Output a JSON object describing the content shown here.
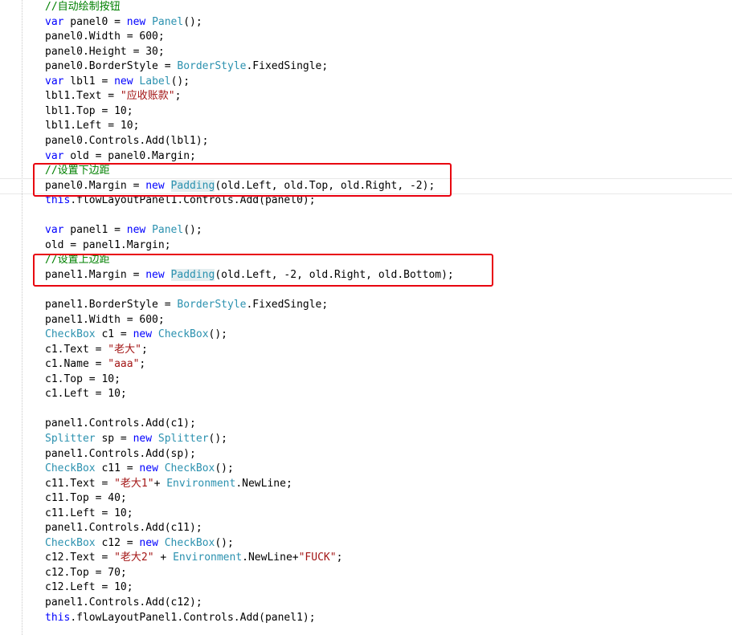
{
  "editor": {
    "lines": [
      [
        {
          "t": "//自动绘制按钮",
          "c": "cmt"
        }
      ],
      [
        {
          "t": "var",
          "c": "kw"
        },
        {
          "t": " panel0 = ",
          "c": "prop"
        },
        {
          "t": "new",
          "c": "kw"
        },
        {
          "t": " ",
          "c": "prop"
        },
        {
          "t": "Panel",
          "c": "type"
        },
        {
          "t": "();",
          "c": "prop"
        }
      ],
      [
        {
          "t": "panel0.Width = 600;",
          "c": "prop"
        }
      ],
      [
        {
          "t": "panel0.Height = 30;",
          "c": "prop"
        }
      ],
      [
        {
          "t": "panel0.BorderStyle = ",
          "c": "prop"
        },
        {
          "t": "BorderStyle",
          "c": "type"
        },
        {
          "t": ".FixedSingle;",
          "c": "prop"
        }
      ],
      [
        {
          "t": "var",
          "c": "kw"
        },
        {
          "t": " lbl1 = ",
          "c": "prop"
        },
        {
          "t": "new",
          "c": "kw"
        },
        {
          "t": " ",
          "c": "prop"
        },
        {
          "t": "Label",
          "c": "type"
        },
        {
          "t": "();",
          "c": "prop"
        }
      ],
      [
        {
          "t": "lbl1.Text = ",
          "c": "prop"
        },
        {
          "t": "\"应收账款\"",
          "c": "str"
        },
        {
          "t": ";",
          "c": "prop"
        }
      ],
      [
        {
          "t": "lbl1.Top = 10;",
          "c": "prop"
        }
      ],
      [
        {
          "t": "lbl1.Left = 10;",
          "c": "prop"
        }
      ],
      [
        {
          "t": "panel0.Controls.Add(lbl1);",
          "c": "prop"
        }
      ],
      [
        {
          "t": "var",
          "c": "kw"
        },
        {
          "t": " old = panel0.Margin;",
          "c": "prop"
        }
      ],
      [
        {
          "t": "//设置下边距",
          "c": "cmt"
        }
      ],
      [
        {
          "t": "panel0.Margin = ",
          "c": "prop"
        },
        {
          "t": "new",
          "c": "kw"
        },
        {
          "t": " ",
          "c": "prop"
        },
        {
          "t": "Padding",
          "c": "hl"
        },
        {
          "t": "(old.Left, old.Top, old.Right, -2);",
          "c": "prop"
        }
      ],
      [
        {
          "t": "this",
          "c": "kw"
        },
        {
          "t": ".flowLayoutPanel1.Controls.Add(panel0);",
          "c": "prop"
        }
      ],
      [],
      [
        {
          "t": "var",
          "c": "kw"
        },
        {
          "t": " panel1 = ",
          "c": "prop"
        },
        {
          "t": "new",
          "c": "kw"
        },
        {
          "t": " ",
          "c": "prop"
        },
        {
          "t": "Panel",
          "c": "type"
        },
        {
          "t": "();",
          "c": "prop"
        }
      ],
      [
        {
          "t": "old = panel1.Margin;",
          "c": "prop"
        }
      ],
      [
        {
          "t": "//设置上边距",
          "c": "cmt"
        }
      ],
      [
        {
          "t": "panel1.Margin = ",
          "c": "prop"
        },
        {
          "t": "new",
          "c": "kw"
        },
        {
          "t": " ",
          "c": "prop"
        },
        {
          "t": "Padding",
          "c": "hl"
        },
        {
          "t": "(old.Left, -2, old.Right, old.Bottom);",
          "c": "prop"
        }
      ],
      [],
      [
        {
          "t": "panel1.BorderStyle = ",
          "c": "prop"
        },
        {
          "t": "BorderStyle",
          "c": "type"
        },
        {
          "t": ".FixedSingle;",
          "c": "prop"
        }
      ],
      [
        {
          "t": "panel1.Width = 600;",
          "c": "prop"
        }
      ],
      [
        {
          "t": "CheckBox",
          "c": "type"
        },
        {
          "t": " c1 = ",
          "c": "prop"
        },
        {
          "t": "new",
          "c": "kw"
        },
        {
          "t": " ",
          "c": "prop"
        },
        {
          "t": "CheckBox",
          "c": "type"
        },
        {
          "t": "();",
          "c": "prop"
        }
      ],
      [
        {
          "t": "c1.Text = ",
          "c": "prop"
        },
        {
          "t": "\"老大\"",
          "c": "str"
        },
        {
          "t": ";",
          "c": "prop"
        }
      ],
      [
        {
          "t": "c1.Name = ",
          "c": "prop"
        },
        {
          "t": "\"aaa\"",
          "c": "str"
        },
        {
          "t": ";",
          "c": "prop"
        }
      ],
      [
        {
          "t": "c1.Top = 10;",
          "c": "prop"
        }
      ],
      [
        {
          "t": "c1.Left = 10;",
          "c": "prop"
        }
      ],
      [],
      [
        {
          "t": "panel1.Controls.Add(c1);",
          "c": "prop"
        }
      ],
      [
        {
          "t": "Splitter",
          "c": "type"
        },
        {
          "t": " sp = ",
          "c": "prop"
        },
        {
          "t": "new",
          "c": "kw"
        },
        {
          "t": " ",
          "c": "prop"
        },
        {
          "t": "Splitter",
          "c": "type"
        },
        {
          "t": "();",
          "c": "prop"
        }
      ],
      [
        {
          "t": "panel1.Controls.Add(sp);",
          "c": "prop"
        }
      ],
      [
        {
          "t": "CheckBox",
          "c": "type"
        },
        {
          "t": " c11 = ",
          "c": "prop"
        },
        {
          "t": "new",
          "c": "kw"
        },
        {
          "t": " ",
          "c": "prop"
        },
        {
          "t": "CheckBox",
          "c": "type"
        },
        {
          "t": "();",
          "c": "prop"
        }
      ],
      [
        {
          "t": "c11.Text = ",
          "c": "prop"
        },
        {
          "t": "\"老大1\"",
          "c": "str"
        },
        {
          "t": "+ ",
          "c": "prop"
        },
        {
          "t": "Environment",
          "c": "type"
        },
        {
          "t": ".NewLine;",
          "c": "prop"
        }
      ],
      [
        {
          "t": "c11.Top = 40;",
          "c": "prop"
        }
      ],
      [
        {
          "t": "c11.Left = 10;",
          "c": "prop"
        }
      ],
      [
        {
          "t": "panel1.Controls.Add(c11);",
          "c": "prop"
        }
      ],
      [
        {
          "t": "CheckBox",
          "c": "type"
        },
        {
          "t": " c12 = ",
          "c": "prop"
        },
        {
          "t": "new",
          "c": "kw"
        },
        {
          "t": " ",
          "c": "prop"
        },
        {
          "t": "CheckBox",
          "c": "type"
        },
        {
          "t": "();",
          "c": "prop"
        }
      ],
      [
        {
          "t": "c12.Text = ",
          "c": "prop"
        },
        {
          "t": "\"老大2\"",
          "c": "str"
        },
        {
          "t": " + ",
          "c": "prop"
        },
        {
          "t": "Environment",
          "c": "type"
        },
        {
          "t": ".NewLine+",
          "c": "prop"
        },
        {
          "t": "\"FUCK\"",
          "c": "str"
        },
        {
          "t": ";",
          "c": "prop"
        }
      ],
      [
        {
          "t": "c12.Top = 70;",
          "c": "prop"
        }
      ],
      [
        {
          "t": "c12.Left = 10;",
          "c": "prop"
        }
      ],
      [
        {
          "t": "panel1.Controls.Add(c12);",
          "c": "prop"
        }
      ],
      [
        {
          "t": "this",
          "c": "kw"
        },
        {
          "t": ".flowLayoutPanel1.Controls.Add(panel1);",
          "c": "prop"
        }
      ]
    ],
    "colors": {
      "keyword": "#0000ff",
      "type": "#2b91af",
      "string": "#a31515",
      "comment": "#008000",
      "annotation_box": "#e8000f"
    }
  }
}
